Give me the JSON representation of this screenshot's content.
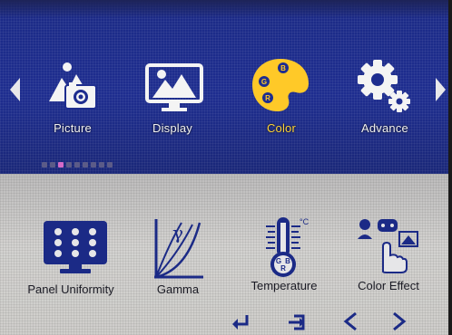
{
  "menu": {
    "items": [
      {
        "label": "Picture",
        "icon": "picture-icon"
      },
      {
        "label": "Display",
        "icon": "display-icon"
      },
      {
        "label": "Color",
        "icon": "color-palette-icon",
        "active": true
      },
      {
        "label": "Advance",
        "icon": "gear-icon"
      }
    ],
    "active_color": "#ffd43a",
    "nav_left_icon": "triangle-left-icon",
    "nav_right_icon": "triangle-right-icon"
  },
  "page_indicator": {
    "count": 9,
    "active_index": 2
  },
  "submenu": {
    "items": [
      {
        "label": "Panel Uniformity",
        "icon": "panel-grid-icon"
      },
      {
        "label": "Gamma",
        "icon": "gamma-curve-icon"
      },
      {
        "label": "Temperature",
        "icon": "thermometer-icon"
      },
      {
        "label": "Color Effect",
        "icon": "color-effect-icon"
      }
    ]
  },
  "palette_letters": [
    "G",
    "B",
    "R"
  ],
  "thermometer_letters": [
    "G",
    "R",
    "B"
  ],
  "thermometer_unit": "°C",
  "gamma_symbol": "γ",
  "footer": {
    "icons": [
      "enter-icon",
      "exit-icon",
      "chevron-left-icon",
      "chevron-right-icon"
    ]
  },
  "colors": {
    "top_band": "#1e2d8f",
    "bottom_band": "#d0cfcd"
  }
}
